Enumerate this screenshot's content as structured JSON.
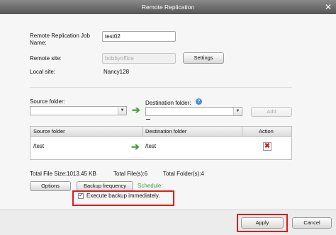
{
  "window": {
    "title": "Remote Replication"
  },
  "form": {
    "job_name_label": "Remote Replication Job Name:",
    "job_name_value": "test02",
    "remote_site_label": "Remote site:",
    "remote_site_value": "bobbyoffice",
    "settings_label": "Settings",
    "local_site_label": "Local site:",
    "local_site_value": "Nancy128"
  },
  "folders": {
    "source_label": "Source folder:",
    "destination_label": "Destination folder:",
    "add_label": "Add"
  },
  "table": {
    "columns": [
      "Source folder",
      "Destination folder",
      "Action"
    ],
    "rows": [
      {
        "source": "/test",
        "destination": "/test"
      }
    ]
  },
  "totals": {
    "size": "Total File Size:1013.45 KB",
    "files": "Total File(s):6",
    "folders": "Total Folder(s):4"
  },
  "options": {
    "options_label": "Options",
    "frequency_label": "Backup frequency",
    "schedule_label": "Schedule:",
    "execute_label": "Execute backup immediately.",
    "execute_checked": true
  },
  "footer": {
    "apply_label": "Apply",
    "cancel_label": "Cancel"
  },
  "colors": {
    "highlight": "#e21a1a",
    "arrow": "#3aa52f",
    "schedule_text": "#3a9a3a"
  },
  "icons": [
    "close-icon",
    "help-icon",
    "arrow-right-icon",
    "delete-icon",
    "checkbox-icon",
    "chevron-down-icon"
  ]
}
